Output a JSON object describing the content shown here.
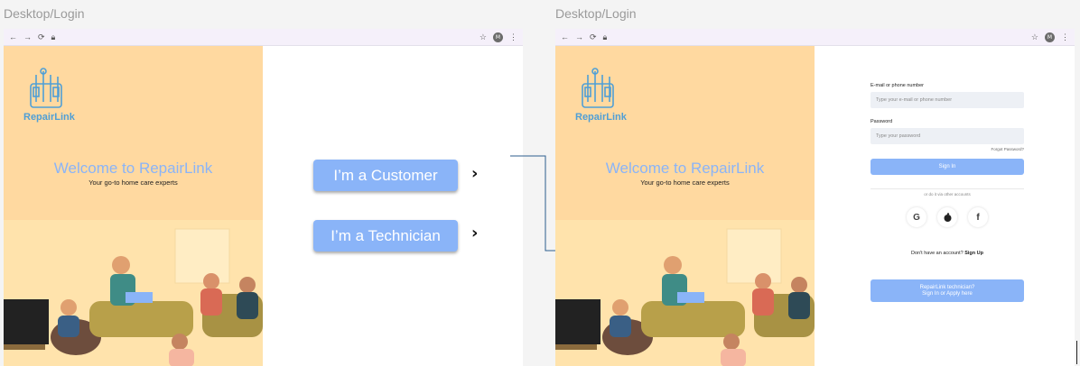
{
  "frames": [
    {
      "label": "Desktop/Login",
      "browser": {
        "avatar": "M"
      },
      "brand": {
        "name": "RepairLink"
      },
      "welcome": "Welcome to RepairLink",
      "tagline": "Your go-to home care experts",
      "buttons": {
        "customer": "I’m a Customer",
        "technician": "I’m a Technician"
      }
    },
    {
      "label": "Desktop/Login",
      "browser": {
        "avatar": "M"
      },
      "brand": {
        "name": "RepairLink"
      },
      "welcome": "Welcome to RepairLink",
      "tagline": "Your go-to home care experts",
      "form": {
        "email_label": "E-mail or phone number",
        "email_placeholder": "Type your e-mail or phone number",
        "password_label": "Password",
        "password_placeholder": "Type your password",
        "forgot": "Forgot Password?",
        "signin": "Sign In",
        "or_text": "or do it via other accounts",
        "no_account": "Don't have an account?",
        "signup": "Sign Up",
        "tech_line1": "RepairLink technician?",
        "tech_line2": "Sign In or Apply here"
      }
    }
  ],
  "icons": {
    "back": "arrow-left-icon",
    "forward": "arrow-right-icon",
    "reload": "reload-icon",
    "lock": "lock-icon",
    "star": "star-icon",
    "menu": "kebab-menu-icon",
    "google": "google-icon",
    "apple": "apple-icon",
    "facebook": "facebook-icon"
  },
  "colors": {
    "accent": "#8ab4f8",
    "panel": "#ffd9a0",
    "brand": "#4f9fd6"
  }
}
